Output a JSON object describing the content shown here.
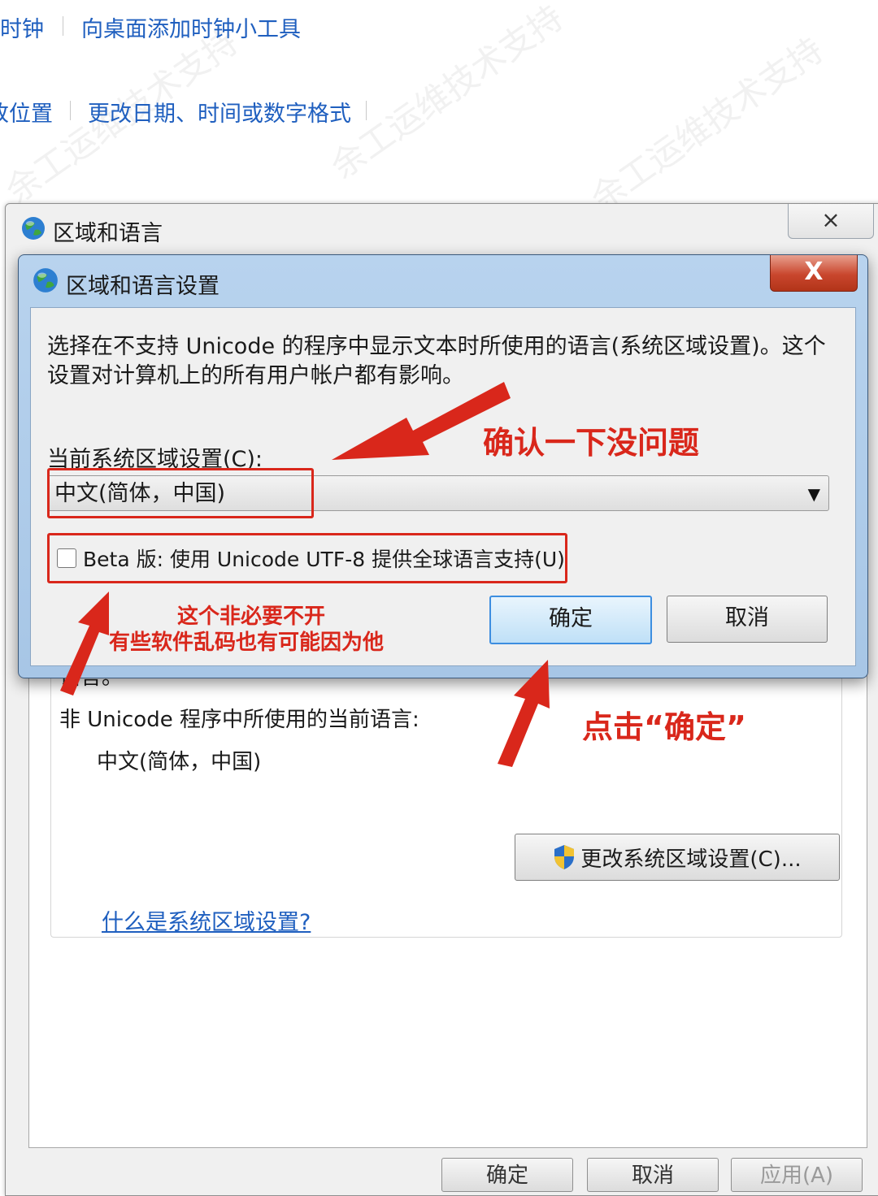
{
  "control_panel": {
    "link_clock": "时钟",
    "link_add_gadget": "向桌面添加时钟小工具",
    "link_location": "改位置",
    "link_change_format": "更改日期、时间或数字格式"
  },
  "back_window": {
    "title": "区域和语言",
    "close_label": "⨯",
    "text_partial": "语言。",
    "current_lang_label": "非 Unicode 程序中所使用的当前语言:",
    "current_lang_value": "中文(简体，中国)",
    "change_locale_btn": "更改系统区域设置(C)...",
    "what_locale_link": "什么是系统区域设置?",
    "bottom_ok": "确定",
    "bottom_cancel": "取消",
    "bottom_apply": "应用(A)"
  },
  "dialog": {
    "title": "区域和语言设置",
    "close_label": "X",
    "description": "选择在不支持 Unicode 的程序中显示文本时所使用的语言(系统区域设置)。这个设置对计算机上的所有用户帐户都有影响。",
    "locale_label": "当前系统区域设置(C):",
    "locale_value": "中文(简体，中国)",
    "beta_label": "Beta 版: 使用 Unicode UTF-8 提供全球语言支持(U)",
    "beta_checked": false,
    "ok_label": "确定",
    "cancel_label": "取消"
  },
  "annotations": {
    "confirm_note": "确认一下没问题",
    "beta_note_line1": "这个非必要不开",
    "beta_note_line2": "有些软件乱码也有可能因为他",
    "click_note": "点击“确定”",
    "color": "#d9271b"
  },
  "watermark": "余工运维技术支持"
}
